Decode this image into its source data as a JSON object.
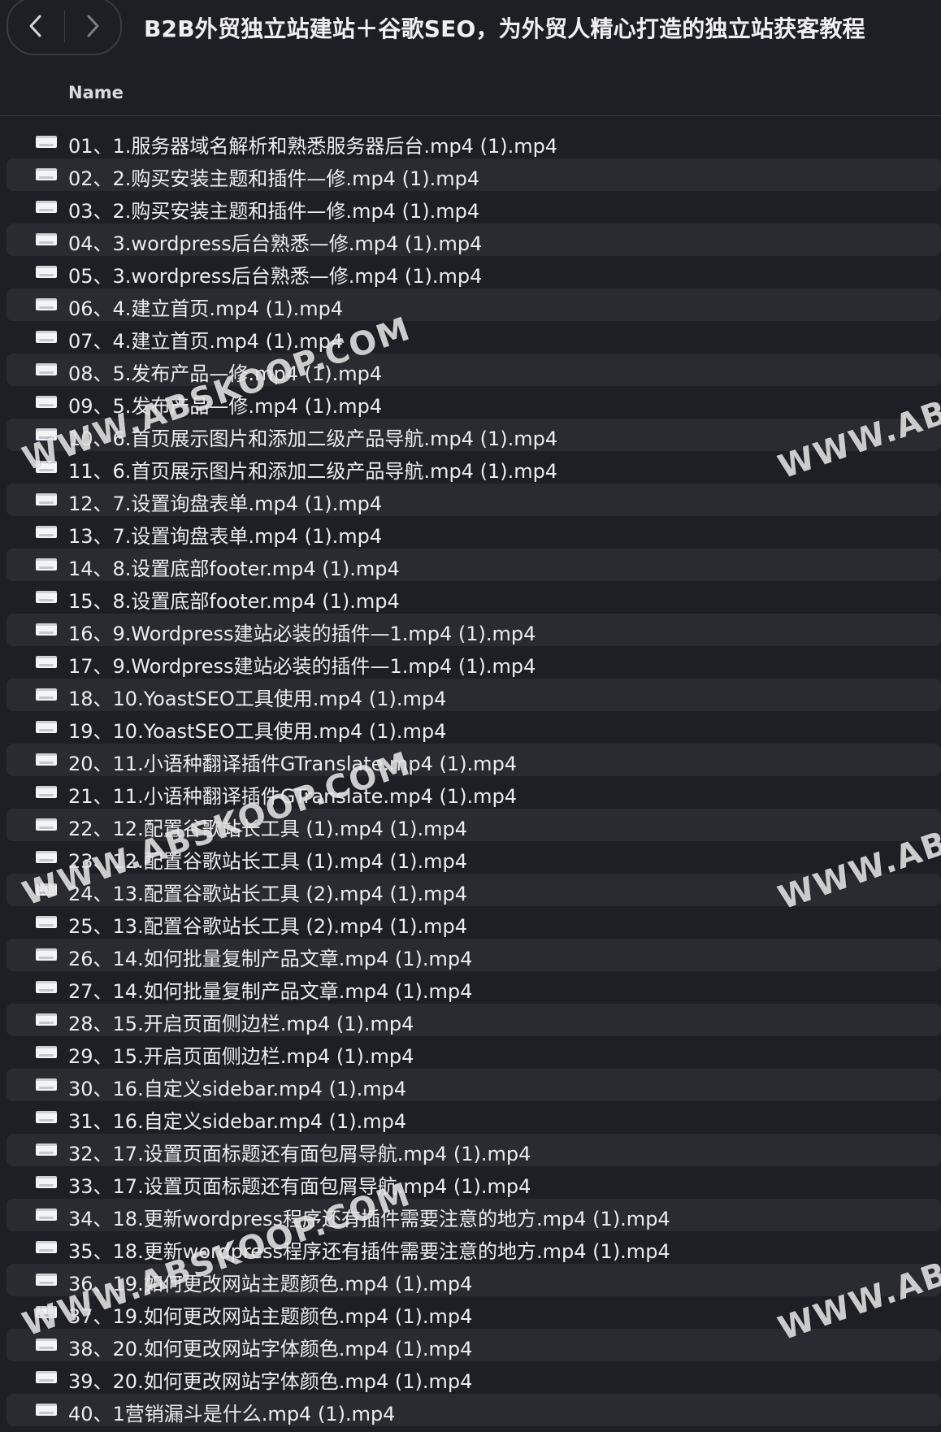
{
  "window": {
    "title": "B2B外贸独立站建站＋谷歌SEO，为外贸人精心打造的独立站获客教程"
  },
  "column_header": {
    "name": "Name"
  },
  "files": [
    "01、1.服务器域名解析和熟悉服务器后台.mp4 (1).mp4",
    "02、2.购买安装主题和插件—修.mp4 (1).mp4",
    "03、2.购买安装主题和插件—修.mp4 (1).mp4",
    "04、3.wordpress后台熟悉—修.mp4 (1).mp4",
    "05、3.wordpress后台熟悉—修.mp4 (1).mp4",
    "06、4.建立首页.mp4 (1).mp4",
    "07、4.建立首页.mp4 (1).mp4",
    "08、5.发布产品—修.mp4 (1).mp4",
    "09、5.发布产品—修.mp4 (1).mp4",
    "10、6.首页展示图片和添加二级产品导航.mp4 (1).mp4",
    "11、6.首页展示图片和添加二级产品导航.mp4 (1).mp4",
    "12、7.设置询盘表单.mp4 (1).mp4",
    "13、7.设置询盘表单.mp4 (1).mp4",
    "14、8.设置底部footer.mp4 (1).mp4",
    "15、8.设置底部footer.mp4 (1).mp4",
    "16、9.Wordpress建站必装的插件—1.mp4 (1).mp4",
    "17、9.Wordpress建站必装的插件—1.mp4 (1).mp4",
    "18、10.YoastSEO工具使用.mp4 (1).mp4",
    "19、10.YoastSEO工具使用.mp4 (1).mp4",
    "20、11.小语种翻译插件GTranslate.mp4 (1).mp4",
    "21、11.小语种翻译插件GTranslate.mp4 (1).mp4",
    "22、12.配置谷歌站长工具 (1).mp4 (1).mp4",
    "23、12.配置谷歌站长工具 (1).mp4 (1).mp4",
    "24、13.配置谷歌站长工具 (2).mp4 (1).mp4",
    "25、13.配置谷歌站长工具 (2).mp4 (1).mp4",
    "26、14.如何批量复制产品文章.mp4 (1).mp4",
    "27、14.如何批量复制产品文章.mp4 (1).mp4",
    "28、15.开启页面侧边栏.mp4 (1).mp4",
    "29、15.开启页面侧边栏.mp4 (1).mp4",
    "30、16.自定义sidebar.mp4 (1).mp4",
    "31、16.自定义sidebar.mp4 (1).mp4",
    "32、17.设置页面标题还有面包屑导航.mp4 (1).mp4",
    "33、17.设置页面标题还有面包屑导航.mp4 (1).mp4",
    "34、18.更新wordpress程序还有插件需要注意的地方.mp4 (1).mp4",
    "35、18.更新wordpress程序还有插件需要注意的地方.mp4 (1).mp4",
    "36、19.如何更改网站主题颜色.mp4 (1).mp4",
    "37、19.如何更改网站主题颜色.mp4 (1).mp4",
    "38、20.如何更改网站字体颜色.mp4 (1).mp4",
    "39、20.如何更改网站字体颜色.mp4 (1).mp4",
    "40、1营销漏斗是什么.mp4 (1).mp4"
  ],
  "watermarks": [
    "WWW.ABSKOOP.COM",
    "WWW.ABS",
    "WWW.ABSKOOP.COM",
    "WWW.ABS",
    "WWW.ABSKOOP.COM",
    "WWW.ABS"
  ],
  "icons": {
    "back": "chevron-left-icon",
    "forward": "chevron-right-icon",
    "file": "video-file-icon"
  },
  "colors": {
    "background": "#1e1f24",
    "row_alt": "#2a2b30",
    "text": "#ececef"
  }
}
